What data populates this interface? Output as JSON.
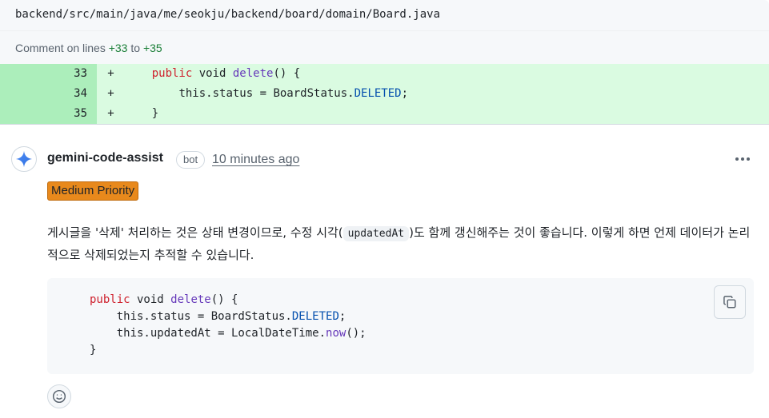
{
  "file": {
    "path": "backend/src/main/java/me/seokju/backend/board/domain/Board.java"
  },
  "comment_range": {
    "prefix": "Comment on lines",
    "start": "+33",
    "connector": "to",
    "end": "+35"
  },
  "diff": {
    "lines": [
      {
        "num": "33",
        "sign": "+",
        "indent": "    ",
        "kw": "public",
        "mid": " void ",
        "fn": "delete",
        "tail": "() {"
      },
      {
        "num": "34",
        "sign": "+",
        "indent": "        ",
        "pre": "this.status = BoardStatus.",
        "const": "DELETED",
        "tail": ";"
      },
      {
        "num": "35",
        "sign": "+",
        "indent": "    ",
        "pre": "}"
      }
    ]
  },
  "comment": {
    "author": "gemini-code-assist",
    "badge": "bot",
    "time": "10 minutes ago",
    "priority": "Medium Priority",
    "text_before": "게시글을 '삭제' 처리하는 것은 상태 변경이므로, 수정 시각(",
    "inline_code": "updatedAt",
    "text_after": ")도 함께 갱신해주는 것이 좋습니다. 이렇게 하면 언제 데이터가 논리적으로 삭제되었는지 추적할 수 있습니다.",
    "code": {
      "l1_kw": "public",
      "l1_mid": " void ",
      "l1_fn": "delete",
      "l1_tail": "() {",
      "l2_pre": "    this.status = BoardStatus.",
      "l2_const": "DELETED",
      "l2_tail": ";",
      "l3_pre": "    this.updatedAt = LocalDateTime.",
      "l3_fn": "now",
      "l3_tail": "();",
      "l4": "}"
    }
  },
  "icons": {
    "avatar": "gemini-sparkle-icon",
    "menu": "kebab-horizontal-icon",
    "copy": "copy-icon",
    "reaction": "smiley-icon"
  },
  "colors": {
    "added_line_bg": "#dafbe1",
    "added_num_bg": "#aceebb",
    "priority_bg": "#e8891c",
    "keyword": "#cf222e",
    "function": "#6639ba",
    "constant": "#0550ae"
  }
}
